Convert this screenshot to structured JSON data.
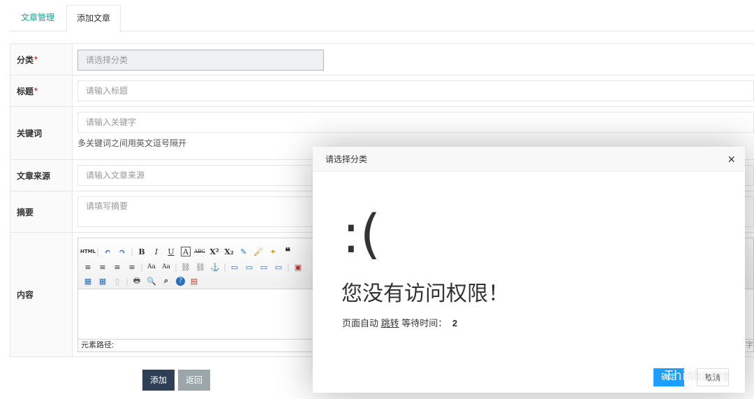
{
  "tabs": [
    {
      "label": "文章管理"
    },
    {
      "label": "添加文章"
    }
  ],
  "form": {
    "category": {
      "label": "分类",
      "required_mark": "*",
      "placeholder": "请选择分类"
    },
    "title": {
      "label": "标题",
      "required_mark": "*",
      "placeholder": "请输入标题"
    },
    "keywords": {
      "label": "关键词",
      "placeholder": "请输入关键字",
      "hint": "多关键词之间用英文逗号隔开"
    },
    "source": {
      "label": "文章来源",
      "placeholder": "请输入文章来源"
    },
    "summary": {
      "label": "摘要",
      "placeholder": "请填写摘要"
    },
    "content": {
      "label": "内容",
      "path_label": "元素路径:",
      "char_count_fragment": "字"
    }
  },
  "editor_toolbar": {
    "row1": [
      "HTML",
      "↶",
      "↷",
      "B",
      "I",
      "U",
      "A",
      "ABC",
      "X²",
      "X₂",
      "✎",
      "🖌",
      "✦",
      "❝"
    ],
    "row2": [
      "≡",
      "≡",
      "≡",
      "≡",
      "Aa",
      "Aa",
      "⛓",
      "⛓",
      "⚓",
      "▭",
      "▭",
      "▭",
      "▭",
      "▣"
    ],
    "row3": [
      "▦",
      "▦",
      "▯",
      "🖶",
      "🔍",
      "⌕",
      "?",
      "▤"
    ]
  },
  "buttons": {
    "add": "添加",
    "back": "返回"
  },
  "modal": {
    "title": "请选择分类",
    "close": "×",
    "face": ":(",
    "message": "您没有访问权限！",
    "wait_prefix": "页面自动",
    "wait_link": "跳转",
    "wait_suffix": "等待时间：",
    "wait_seconds": "2",
    "ok_button": "确定",
    "cancel_button": "取消"
  },
  "watermark": "Thinkcms"
}
